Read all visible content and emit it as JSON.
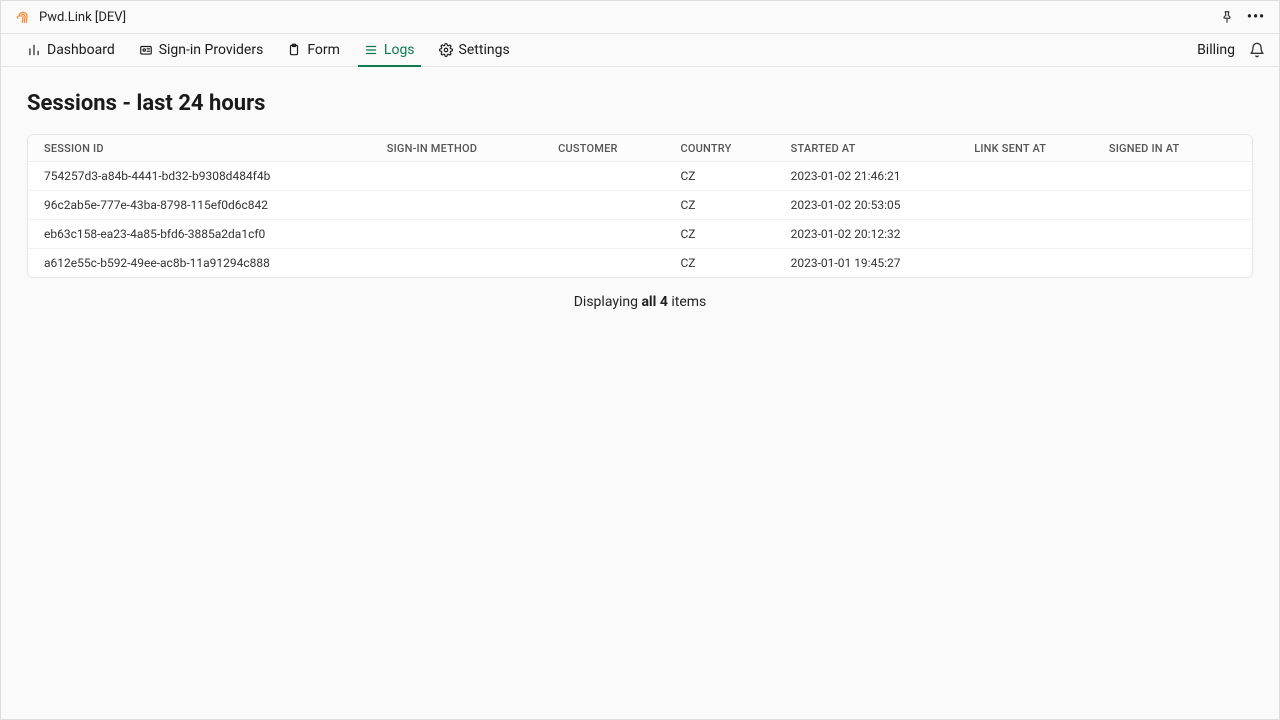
{
  "header": {
    "app_title": "Pwd.Link [DEV]"
  },
  "nav": {
    "tabs": [
      {
        "label": "Dashboard",
        "active": false
      },
      {
        "label": "Sign-in Providers",
        "active": false
      },
      {
        "label": "Form",
        "active": false
      },
      {
        "label": "Logs",
        "active": true
      },
      {
        "label": "Settings",
        "active": false
      }
    ],
    "billing_label": "Billing"
  },
  "page": {
    "title": "Sessions - last 24 hours"
  },
  "table": {
    "columns": [
      "SESSION ID",
      "SIGN-IN METHOD",
      "CUSTOMER",
      "COUNTRY",
      "STARTED AT",
      "LINK SENT AT",
      "SIGNED IN AT"
    ],
    "rows": [
      {
        "session_id": "754257d3-a84b-4441-bd32-b9308d484f4b",
        "signin_method": "",
        "customer": "",
        "country": "CZ",
        "started_at": "2023-01-02 21:46:21",
        "link_sent_at": "",
        "signed_in_at": ""
      },
      {
        "session_id": "96c2ab5e-777e-43ba-8798-115ef0d6c842",
        "signin_method": "",
        "customer": "",
        "country": "CZ",
        "started_at": "2023-01-02 20:53:05",
        "link_sent_at": "",
        "signed_in_at": ""
      },
      {
        "session_id": "eb63c158-ea23-4a85-bfd6-3885a2da1cf0",
        "signin_method": "",
        "customer": "",
        "country": "CZ",
        "started_at": "2023-01-02 20:12:32",
        "link_sent_at": "",
        "signed_in_at": ""
      },
      {
        "session_id": "a612e55c-b592-49ee-ac8b-11a91294c888",
        "signin_method": "",
        "customer": "",
        "country": "CZ",
        "started_at": "2023-01-01 19:45:27",
        "link_sent_at": "",
        "signed_in_at": ""
      }
    ]
  },
  "summary": {
    "prefix": "Displaying ",
    "bold": "all 4",
    "suffix": " items"
  },
  "colors": {
    "accent": "#0f7a4e",
    "logo": "#f98e3c"
  }
}
